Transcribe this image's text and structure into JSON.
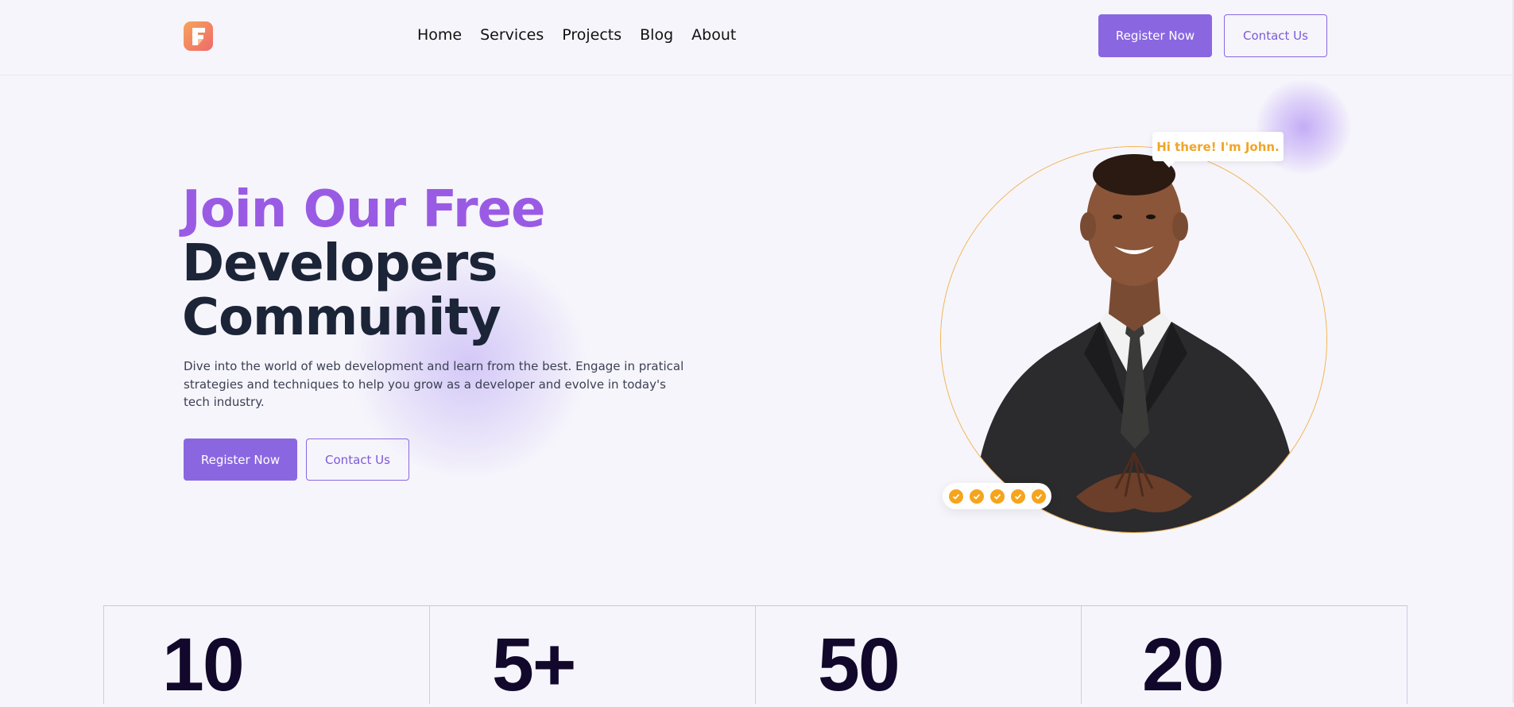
{
  "header": {
    "logo_icon": "brand-logo-icon",
    "nav": [
      {
        "label": "Home"
      },
      {
        "label": "Services"
      },
      {
        "label": "Projects"
      },
      {
        "label": "Blog"
      },
      {
        "label": "About"
      }
    ],
    "register_label": "Register Now",
    "contact_label": "Contact Us"
  },
  "hero": {
    "title_line1": "Join Our Free",
    "title_line2": "Developers",
    "title_line3": "Community",
    "description": "Dive into the world of web development and learn from the best. Engage in pratical strategies and techniques to help you grow as a developer and evolve in today's tech industry.",
    "register_label": "Register Now",
    "contact_label": "Contact Us",
    "greeting": "Hi there! I'm John.",
    "rating_icons": 5
  },
  "stats": [
    {
      "value": "10"
    },
    {
      "value": "5+"
    },
    {
      "value": "50"
    },
    {
      "value": "20"
    }
  ],
  "colors": {
    "accent": "#8a67e0",
    "title_purple": "#9a5be4",
    "title_dark": "#1c2438",
    "greeting_orange": "#f1a525",
    "circle_border": "#f2b24d",
    "background": "#f6f5fb"
  }
}
